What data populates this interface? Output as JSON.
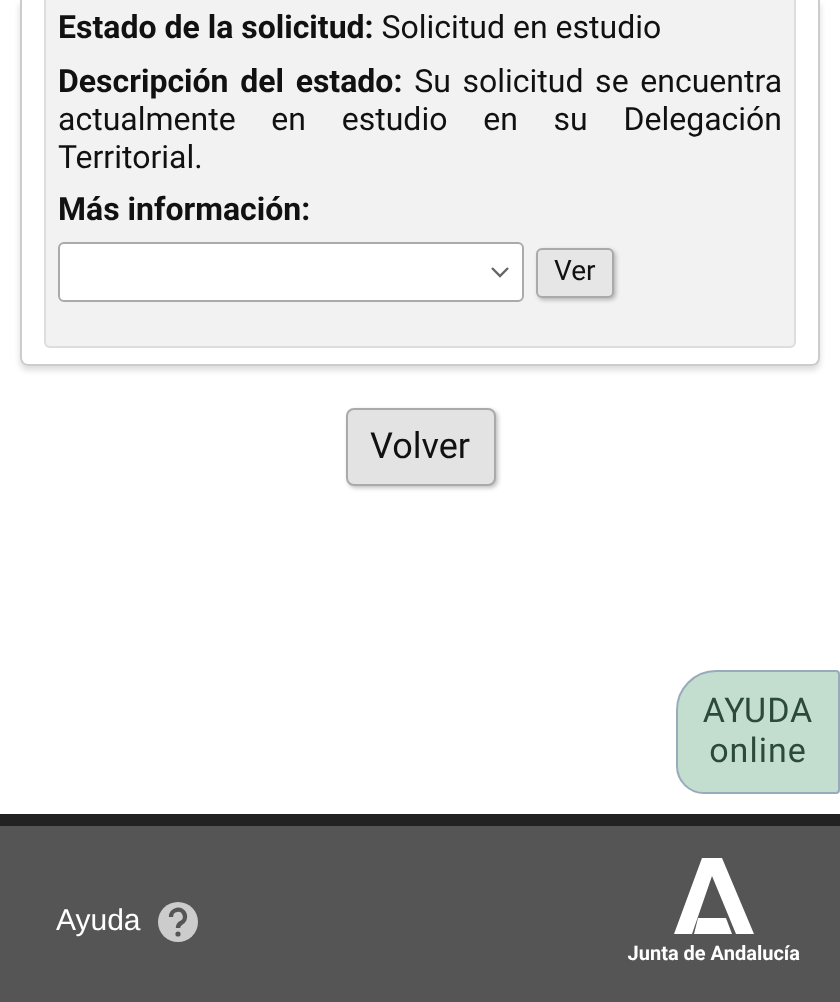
{
  "status": {
    "label": "Estado de la solicitud:",
    "value": "Solicitud en estudio"
  },
  "description": {
    "label": "Descripción del estado:",
    "value": "Su solicitud se encuentra actualmente en estudio en su Delegación Territorial."
  },
  "more_info": {
    "label": "Más información:",
    "button": "Ver"
  },
  "back_button": "Volver",
  "help_online": {
    "line_1": "AYUDA",
    "line_2": "online"
  },
  "footer": {
    "help": "Ayuda",
    "logo_text": "Junta de Andalucía"
  }
}
